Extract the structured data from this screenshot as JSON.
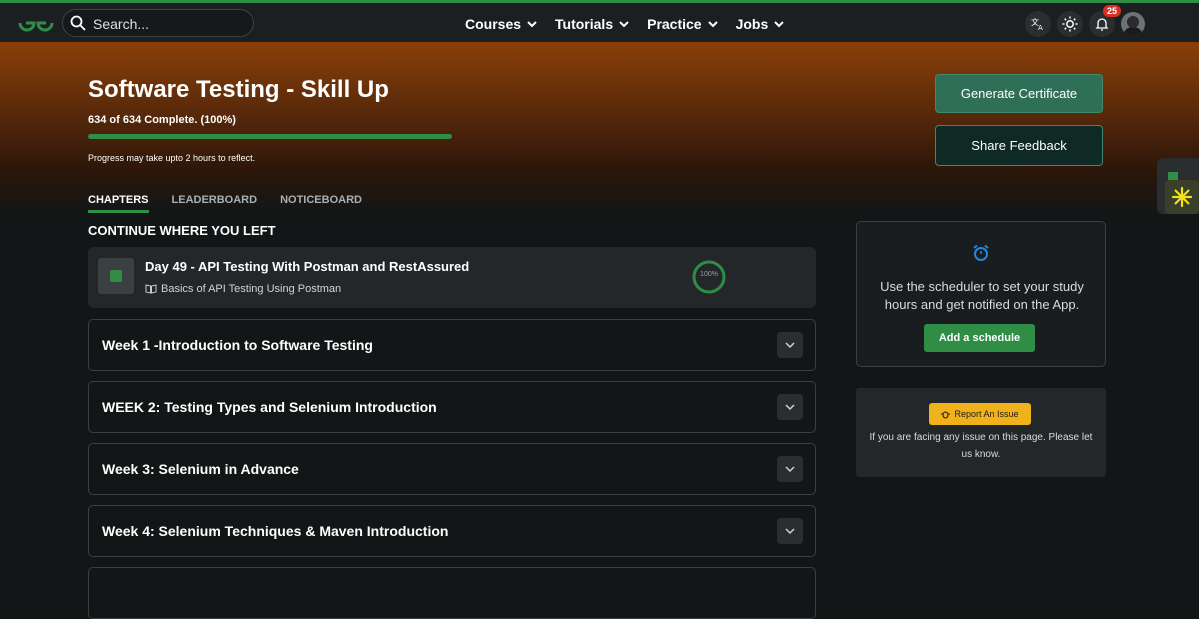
{
  "nav": {
    "search_placeholder": "Search...",
    "menu": [
      "Courses",
      "Tutorials",
      "Practice",
      "Jobs"
    ],
    "notification_count": "25"
  },
  "hero": {
    "title": "Software Testing - Skill Up",
    "progress_text": "634 of 634 Complete. (100%)",
    "progress_fraction": 1.0,
    "note": "Progress may take upto 2 hours to reflect.",
    "generate_certificate": "Generate Certificate",
    "share_feedback": "Share Feedback",
    "tabs": [
      "CHAPTERS",
      "LEADERBOARD",
      "NOTICEBOARD"
    ]
  },
  "continue": {
    "heading": "CONTINUE WHERE YOU LEFT",
    "lesson": "Day 49 - API Testing With Postman and RestAssured",
    "sub": "Basics of API Testing Using Postman",
    "percent": "100%"
  },
  "weeks": [
    "Week 1 -Introduction to Software Testing",
    "WEEK 2: Testing Types and Selenium Introduction",
    "Week 3: Selenium in Advance",
    "Week 4: Selenium Techniques & Maven Introduction",
    ""
  ],
  "scheduler": {
    "text": "Use the scheduler to set your study hours and get notified on the App.",
    "button": "Add a schedule"
  },
  "report": {
    "button": "Report An Issue",
    "text": "If you are facing any issue on this page. Please let us know."
  },
  "colors": {
    "accent": "#2f8d46",
    "report": "#f0b21b"
  }
}
